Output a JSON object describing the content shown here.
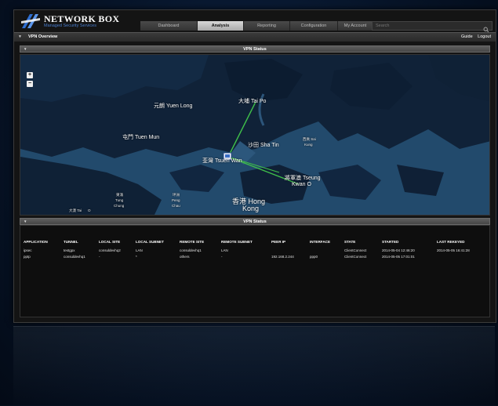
{
  "brand": {
    "name": "NETWORK BOX",
    "tagline": "Managed Security Services"
  },
  "nav": {
    "tabs": [
      {
        "label": "Dashboard",
        "active": false
      },
      {
        "label": "Analysis",
        "active": true
      },
      {
        "label": "Reporting",
        "active": false
      },
      {
        "label": "Configuration",
        "active": false
      },
      {
        "label": "My Account",
        "active": false
      }
    ]
  },
  "search": {
    "placeholder": "Search"
  },
  "subbar": {
    "title": "VPN Overview",
    "guide": "Guide",
    "logout": "Logout"
  },
  "map_panel": {
    "title": "VPN Status",
    "zoom_in": "+",
    "zoom_out": "−"
  },
  "map_labels": {
    "yuen_long": "元朗 Yuen Long",
    "tai_po": "大埔 Tai Po",
    "tuen_mun": "屯門 Tuen Mun",
    "sha_tin": "沙田 Sha Tin",
    "sai_kung_cn": "西貢 Sai",
    "sai_kung_en": "Kung",
    "tsuen_wan": "荃灣 Tsuen Wan",
    "tseung_kwan_o": "將軍澳 Tseung",
    "tseung_kwan_o_2": "Kwan O",
    "hong_kong": "香港 Hong",
    "hong_kong_2": "Kong",
    "tung_chung": "東涌",
    "tung_chung_en": "Tung",
    "tung_chung_en2": "Chung",
    "peng_chau": "坪洲",
    "peng_chau_en": "Peng",
    "peng_chau_en2": "Chau",
    "tai_o": "大澳 Tai",
    "tai_o_2": "O"
  },
  "table_panel": {
    "title": "VPN Status",
    "columns": [
      "APPLICATION",
      "TUNNEL",
      "LOCAL SITE",
      "LOCAL SUBNET",
      "REMOTE SITE",
      "REMOTE SUBNET",
      "PEER IP",
      "INTERFACE",
      "STATE",
      "STARTED",
      "LAST REKEYED"
    ],
    "rows": [
      [
        "ipsec",
        "testgpx",
        "consuldevhq2",
        "LAN",
        "consuldevhq1",
        "LAN",
        "",
        "",
        "ClientConnect",
        "2014-05-04 12:46:20",
        "2014-05-05 16:41:28"
      ],
      [
        "pptp",
        "consuldevhq1",
        "-",
        "*",
        "others",
        "-",
        "192.168.2.244",
        "ppp0",
        "ClientConnect",
        "2014-05-05 17:01:01",
        ""
      ]
    ]
  },
  "colors": {
    "accent": "#4a7fd0",
    "vpn_link": "#3fbf4a"
  }
}
